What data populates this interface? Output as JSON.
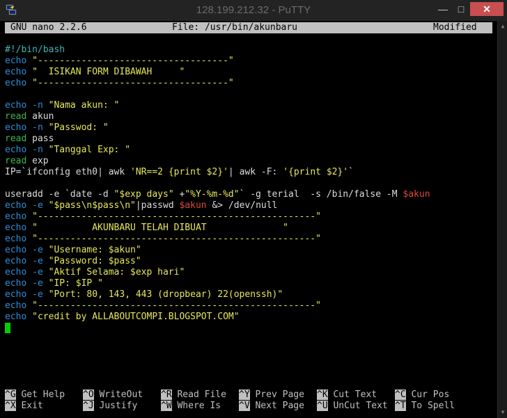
{
  "window": {
    "title": "128.199.212.32 - PuTTY"
  },
  "nano": {
    "version": "GNU nano 2.2.6",
    "file": "File: /usr/bin/akunbaru",
    "status": "Modified"
  },
  "script": {
    "shebang": "#!/bin/bash",
    "echo": "echo",
    "read": "read",
    "l2": "\"-----------------------------------\"",
    "l3": "\"  ISIKAN FORM DIBAWAH     \"",
    "l4": "\"-----------------------------------\"",
    "l6flag": "-n",
    "l6": "\"Nama akun: \"",
    "l7": "akun",
    "l8flag": "-n",
    "l8": "\"Passwod: \"",
    "l9": "pass",
    "l10flag": "-n",
    "l10": "\"Tanggal Exp: \"",
    "l11": "exp",
    "l12a": "IP=`ifconfig eth0",
    "l12b": "| awk ",
    "l12c": "'NR==2 {print $2}'",
    "l12d": "| awk -F: ",
    "l12e": "'{print $2}'",
    "l12f": "`",
    "l14a": "useradd -e `date -d ",
    "l14b": "\"$exp days\"",
    "l14c": " +",
    "l14d": "\"%Y-%m-%d\"",
    "l14e": "` -g terial  -s /bin/false -M ",
    "l14f": "$akun",
    "l15flag": "-e",
    "l15a": "\"$pass\\n$pass\\n\"",
    "l15b": "|passwd ",
    "l15c": "$akun",
    "l15d": " &> /dev/null",
    "l16": "\"---------------------------------------------------\"",
    "l17": "\"          AKUNBARU TELAH DIBUAT              \"",
    "l18": "\"---------------------------------------------------\"",
    "l19flag": "-e",
    "l19": "\"Username: $akun\"",
    "l20flag": "-e",
    "l20": "\"Password: $pass\"",
    "l21flag": "-e",
    "l21": "\"Aktif Selama: $exp hari\"",
    "l22flag": "-e",
    "l22": "\"IP: $IP \"",
    "l23flag": "-e",
    "l23": "\"Port: 80, 143, 443 (dropbear) 22(openssh)\"",
    "l24": "\"---------------------------------------------------\"",
    "l25": "\"credit by ALLABOUTCOMPI.BLOGSPOT.COM\""
  },
  "shortcuts": [
    {
      "key": "^G",
      "label": " Get Help"
    },
    {
      "key": "^O",
      "label": " WriteOut"
    },
    {
      "key": "^R",
      "label": " Read File"
    },
    {
      "key": "^Y",
      "label": " Prev Page"
    },
    {
      "key": "^K",
      "label": " Cut Text"
    },
    {
      "key": "^C",
      "label": " Cur Pos"
    },
    {
      "key": "^X",
      "label": " Exit"
    },
    {
      "key": "^J",
      "label": " Justify"
    },
    {
      "key": "^W",
      "label": " Where Is"
    },
    {
      "key": "^V",
      "label": " Next Page"
    },
    {
      "key": "^U",
      "label": " UnCut Text"
    },
    {
      "key": "^T",
      "label": " To Spell"
    }
  ],
  "colors": {
    "close": "#c74f4f",
    "keyword": "#2d8ed6",
    "string": "#e7e75a",
    "variable": "#e0463a",
    "comment": "#3fb7b7",
    "cursor": "#00d000"
  }
}
